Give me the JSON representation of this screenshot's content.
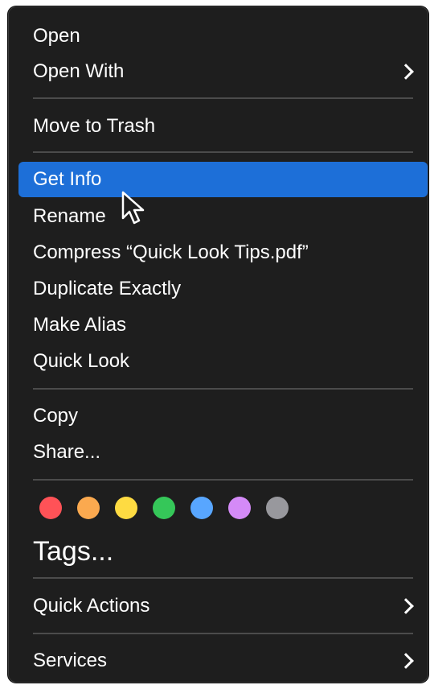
{
  "menu": {
    "items": [
      {
        "label": "Open",
        "submenu": false
      },
      {
        "label": "Open With",
        "submenu": true
      },
      {
        "label": "Move to Trash",
        "submenu": false
      },
      {
        "label": "Get Info",
        "submenu": false,
        "selected": true
      },
      {
        "label": "Rename",
        "submenu": false
      },
      {
        "label": "Compress “Quick Look Tips.pdf”",
        "submenu": false
      },
      {
        "label": "Duplicate Exactly",
        "submenu": false
      },
      {
        "label": "Make Alias",
        "submenu": false
      },
      {
        "label": "Quick Look",
        "submenu": false
      },
      {
        "label": "Copy",
        "submenu": false
      },
      {
        "label": "Share...",
        "submenu": false
      },
      {
        "label": "Tags...",
        "submenu": false
      },
      {
        "label": "Quick Actions",
        "submenu": true
      },
      {
        "label": "Services",
        "submenu": true
      }
    ],
    "tag_colors": [
      {
        "name": "red",
        "color": "#ff5257"
      },
      {
        "name": "orange",
        "color": "#fba94f"
      },
      {
        "name": "yellow",
        "color": "#fedb42"
      },
      {
        "name": "green",
        "color": "#35c759"
      },
      {
        "name": "blue",
        "color": "#58a6ff"
      },
      {
        "name": "purple",
        "color": "#d48af7"
      },
      {
        "name": "gray",
        "color": "#98989d"
      }
    ],
    "selected_color": "#1d6fd8",
    "background_color": "#1e1e1e"
  }
}
